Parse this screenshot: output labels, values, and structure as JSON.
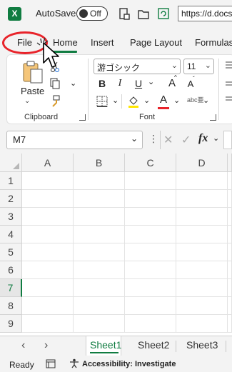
{
  "title_bar": {
    "autosave_label": "AutoSave",
    "autosave_state": "Off",
    "url": "https://d.docs"
  },
  "ribbon_tabs": [
    "File",
    "Home",
    "Insert",
    "Page Layout",
    "Formulas"
  ],
  "active_tab": "Home",
  "clipboard": {
    "paste_label": "Paste",
    "group_label": "Clipboard"
  },
  "font": {
    "font_name": "游ゴシック",
    "font_size": "11",
    "bold": "B",
    "italic": "I",
    "underline": "U",
    "grow": "A",
    "shrink": "A",
    "phonetic": "abc亜",
    "group_label": "Font",
    "font_color": "#e8232a",
    "fill_color": "#ffe600"
  },
  "formula_bar": {
    "name_box": "M7",
    "fx": "fx"
  },
  "grid": {
    "columns": [
      "A",
      "B",
      "C",
      "D"
    ],
    "rows": [
      "1",
      "2",
      "3",
      "4",
      "5",
      "6",
      "7",
      "8",
      "9"
    ],
    "active_row": "7"
  },
  "sheets": [
    "Sheet1",
    "Sheet2",
    "Sheet3"
  ],
  "active_sheet": "Sheet1",
  "status": {
    "ready": "Ready",
    "accessibility": "Accessibility: Investigate"
  },
  "colors": {
    "accent": "#107c41",
    "highlight": "#e8232a"
  }
}
